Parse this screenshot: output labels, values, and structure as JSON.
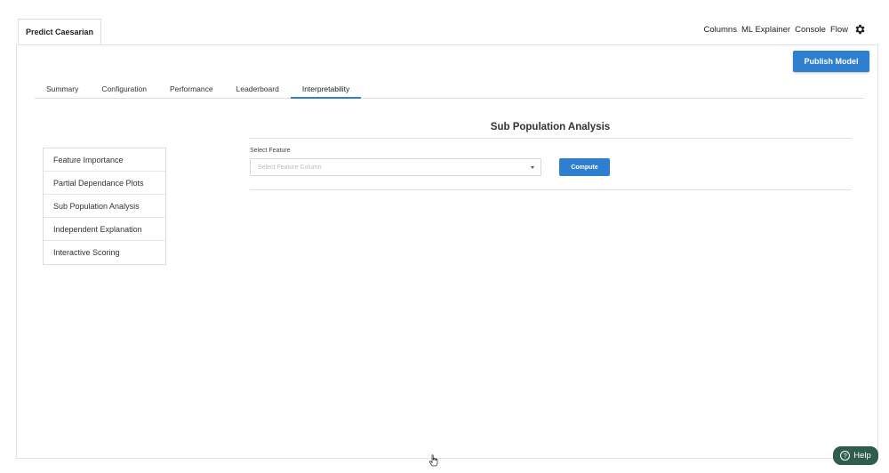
{
  "doc_tab": {
    "label": "Predict Caesarian"
  },
  "top_links": {
    "columns": "Columns",
    "ml_explainer": "ML Explainer",
    "console": "Console",
    "flow": "Flow",
    "settings_icon": "gear-icon"
  },
  "toolbar": {
    "publish_label": "Publish Model"
  },
  "tabs": [
    {
      "label": "Summary",
      "active": false
    },
    {
      "label": "Configuration",
      "active": false
    },
    {
      "label": "Performance",
      "active": false
    },
    {
      "label": "Leaderboard",
      "active": false
    },
    {
      "label": "Interpretability",
      "active": true
    }
  ],
  "sidebar": {
    "items": [
      {
        "label": "Feature Importance"
      },
      {
        "label": "Partial Dependance Plots"
      },
      {
        "label": "Sub Population Analysis"
      },
      {
        "label": "Independent Explanation"
      },
      {
        "label": "Interactive Scoring"
      }
    ]
  },
  "main": {
    "title": "Sub Population Analysis",
    "select_label": "Select Feature",
    "select_placeholder": "Select Feature Column",
    "compute_label": "Compute"
  },
  "help": {
    "label": "Help",
    "icon": "question-circle-icon"
  },
  "colors": {
    "accent": "#2f7fd0",
    "help_bg": "#2e5d4e"
  }
}
